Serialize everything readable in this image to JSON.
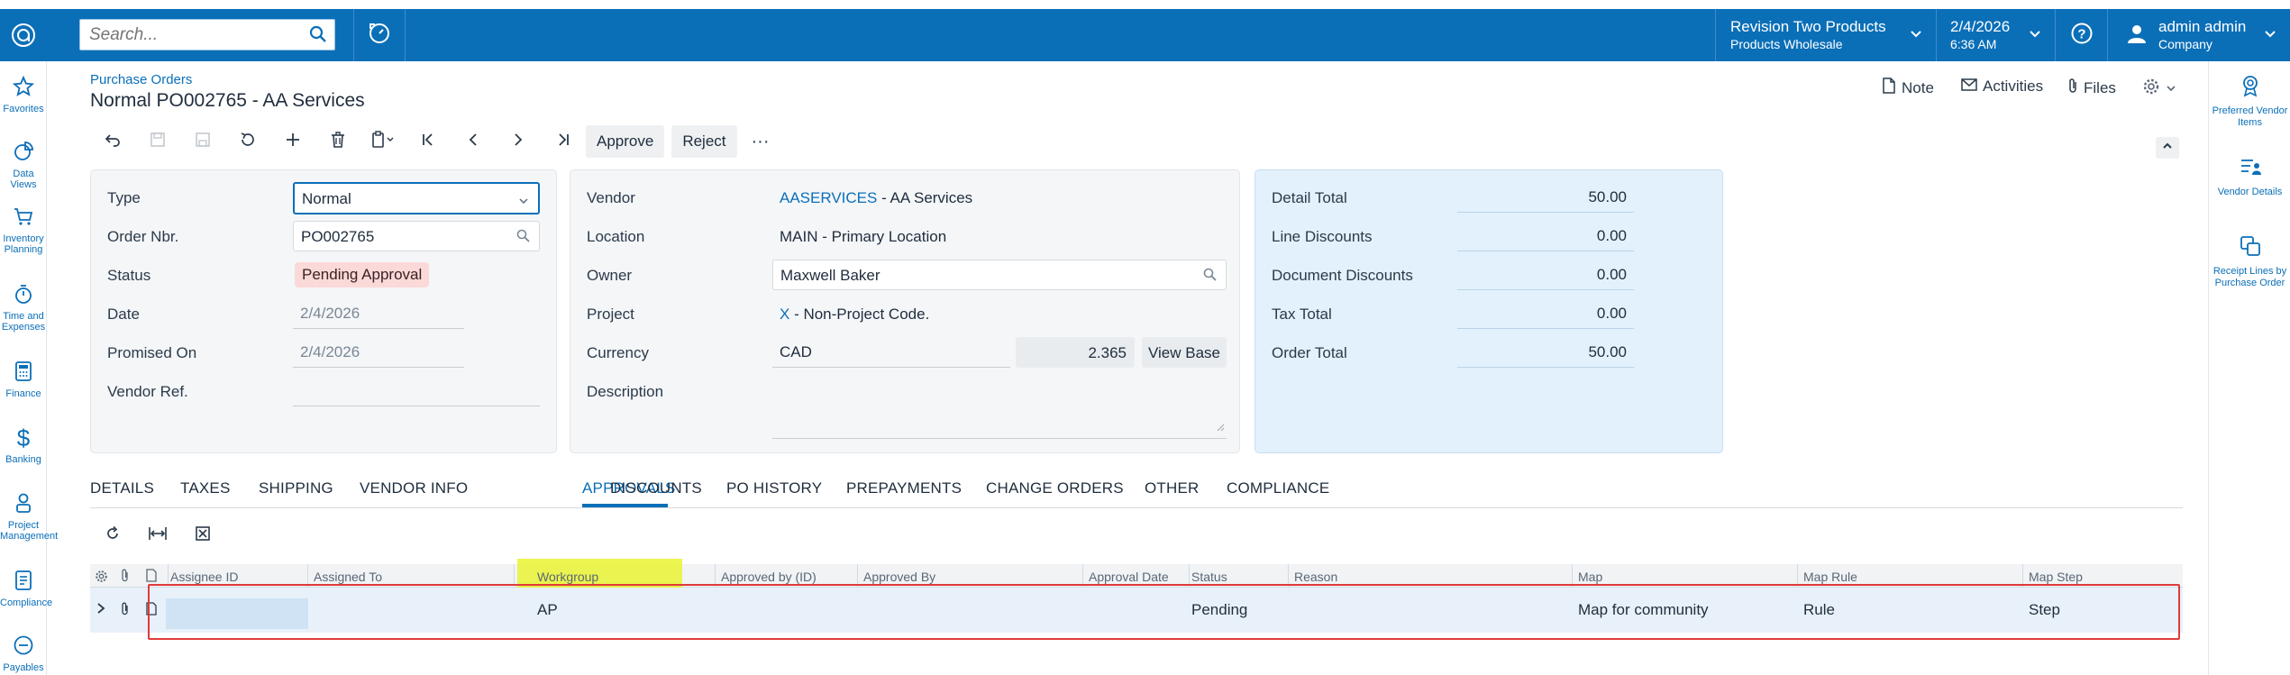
{
  "topbar": {
    "search_placeholder": "Search...",
    "company_line1": "Revision Two Products",
    "company_line2": "Products Wholesale",
    "date": "2/4/2026",
    "time": "6:36 AM",
    "user_name": "admin admin",
    "user_company": "Company"
  },
  "sidebar": {
    "items": [
      {
        "label": "Favorites",
        "icon": "star-icon"
      },
      {
        "label": "Data Views",
        "icon": "pie-chart-icon"
      },
      {
        "label": "Inventory Planning",
        "icon": "cart-icon"
      },
      {
        "label": "Time and Expenses",
        "icon": "stopwatch-icon"
      },
      {
        "label": "Finance",
        "icon": "calculator-icon"
      },
      {
        "label": "Banking",
        "icon": "dollar-icon"
      },
      {
        "label": "Project Management",
        "icon": "person-icon"
      },
      {
        "label": "Compliance",
        "icon": "document-icon"
      },
      {
        "label": "Payables",
        "icon": "minus-circle-icon"
      }
    ]
  },
  "rightbar": {
    "items": [
      {
        "label": "Preferred Vendor Items"
      },
      {
        "label": "Vendor Details"
      },
      {
        "label": "Receipt Lines by Purchase Order"
      }
    ]
  },
  "header": {
    "breadcrumb": "Purchase Orders",
    "title": "Normal PO002765 - AA Services",
    "note": "Note",
    "activities": "Activities",
    "files": "Files"
  },
  "toolbar": {
    "approve": "Approve",
    "reject": "Reject",
    "more": "···"
  },
  "summary": {
    "type_label": "Type",
    "type_value": "Normal",
    "order_nbr_label": "Order Nbr.",
    "order_nbr_value": "PO002765",
    "status_label": "Status",
    "status_value": "Pending Approval",
    "date_label": "Date",
    "date_value": "2/4/2026",
    "promised_label": "Promised On",
    "promised_value": "2/4/2026",
    "vendor_ref_label": "Vendor Ref.",
    "vendor_label": "Vendor",
    "vendor_id": "AASERVICES",
    "vendor_name": " - AA Services",
    "location_label": "Location",
    "location_value": "MAIN - Primary Location",
    "owner_label": "Owner",
    "owner_value": "Maxwell Baker",
    "project_label": "Project",
    "project_id": "X",
    "project_name": " - Non-Project Code.",
    "currency_label": "Currency",
    "currency_value": "CAD",
    "currency_rate": "2.365",
    "view_base": "View Base",
    "description_label": "Description"
  },
  "totals": {
    "detail_total_label": "Detail Total",
    "detail_total": "50.00",
    "line_discounts_label": "Line Discounts",
    "line_discounts": "0.00",
    "doc_discounts_label": "Document Discounts",
    "doc_discounts": "0.00",
    "tax_total_label": "Tax Total",
    "tax_total": "0.00",
    "order_total_label": "Order Total",
    "order_total": "50.00"
  },
  "tabs": [
    "DETAILS",
    "TAXES",
    "SHIPPING",
    "VENDOR INFO",
    "APPROVALS",
    "DISCOUNTS",
    "PO HISTORY",
    "PREPAYMENTS",
    "CHANGE ORDERS",
    "OTHER",
    "COMPLIANCE"
  ],
  "grid": {
    "columns": [
      "Assignee ID",
      "Assigned To",
      "Workgroup",
      "Approved by (ID)",
      "Approved By",
      "Approval Date",
      "Status",
      "Reason",
      "Map",
      "Map Rule",
      "Map Step"
    ],
    "row": {
      "workgroup": "AP",
      "status": "Pending",
      "map": "Map for community",
      "map_rule": "Rule",
      "map_step": "Step"
    }
  },
  "colors": {
    "brand": "#0b6fb8",
    "highlight": "#e9f231",
    "annotation_box": "#e03a3a"
  }
}
